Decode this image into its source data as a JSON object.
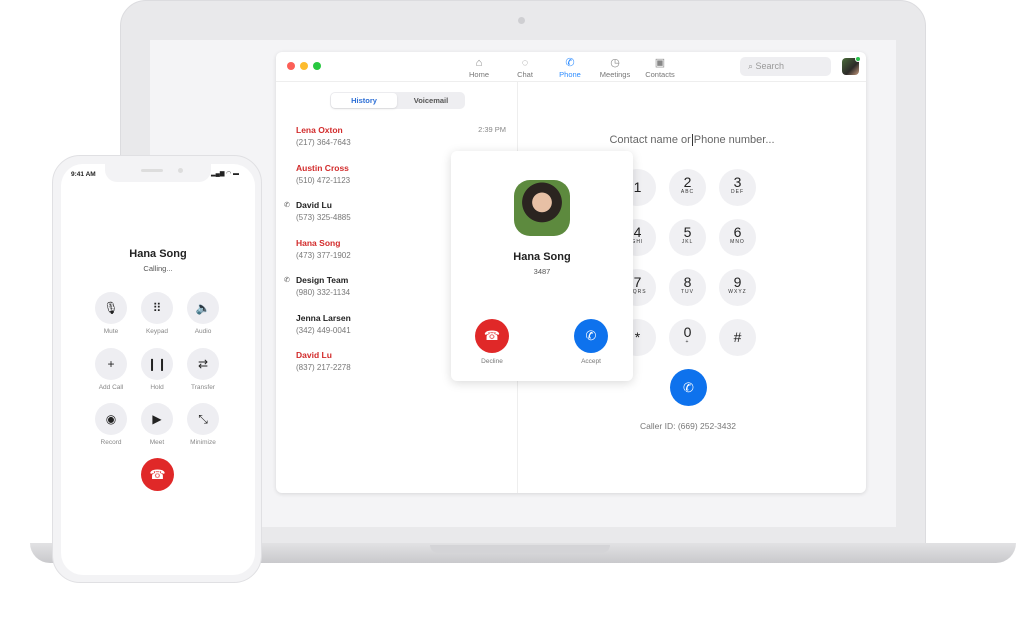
{
  "window": {
    "nav": [
      {
        "label": "Home",
        "icon": "home-icon"
      },
      {
        "label": "Chat",
        "icon": "chat-icon"
      },
      {
        "label": "Phone",
        "icon": "phone-icon",
        "active": true
      },
      {
        "label": "Meetings",
        "icon": "clock-icon"
      },
      {
        "label": "Contacts",
        "icon": "contacts-icon"
      }
    ],
    "search_placeholder": "Search"
  },
  "history": {
    "tabs": [
      "History",
      "Voicemail"
    ],
    "entries": [
      {
        "name": "Lena Oxton",
        "phone": "(217) 364-7643",
        "time": "2:39 PM",
        "missed": true
      },
      {
        "name": "Austin Cross",
        "phone": "(510) 472-1123",
        "missed": true
      },
      {
        "name": "David Lu",
        "phone": "(573) 325-4885",
        "missed": false,
        "outgoing": true
      },
      {
        "name": "Hana Song",
        "phone": "(473) 377-1902",
        "missed": true
      },
      {
        "name": "Design Team",
        "phone": "(980) 332-1134",
        "missed": false,
        "outgoing": true
      },
      {
        "name": "Jenna Larsen",
        "phone": "(342) 449-0041",
        "missed": false
      },
      {
        "name": "David Lu",
        "phone": "(837) 217-2278",
        "missed": true
      }
    ]
  },
  "dialer": {
    "placeholder_before": "Contact name or",
    "placeholder_after": "Phone number...",
    "keys": [
      [
        "1",
        ""
      ],
      [
        "2",
        "ABC"
      ],
      [
        "3",
        "DEF"
      ],
      [
        "4",
        "GHI"
      ],
      [
        "5",
        "JKL"
      ],
      [
        "6",
        "MNO"
      ],
      [
        "7",
        "PQRS"
      ],
      [
        "8",
        "TUV"
      ],
      [
        "9",
        "WXYZ"
      ],
      [
        "*",
        ""
      ],
      [
        "0",
        "+"
      ],
      [
        "#",
        ""
      ]
    ],
    "caller_id": "Caller ID: (669) 252-3432"
  },
  "incoming": {
    "name": "Hana Song",
    "ext": "3487",
    "decline": "Decline",
    "accept": "Accept"
  },
  "mobile": {
    "time": "9:41 AM",
    "name": "Hana Song",
    "status": "Calling...",
    "buttons": [
      {
        "label": "Mute",
        "icon": "🎙"
      },
      {
        "label": "Keypad",
        "icon": "⠿"
      },
      {
        "label": "Audio",
        "icon": "🔈"
      },
      {
        "label": "Add Call",
        "icon": "+"
      },
      {
        "label": "Hold",
        "icon": "❙❙"
      },
      {
        "label": "Transfer",
        "icon": "⇄"
      },
      {
        "label": "Record",
        "icon": "◉"
      },
      {
        "label": "Meet",
        "icon": "▶"
      },
      {
        "label": "Minimize",
        "icon": "⤡"
      }
    ]
  },
  "colors": {
    "accent": "#0e72ed",
    "decline": "#e02828",
    "missed": "#d22b2b"
  }
}
